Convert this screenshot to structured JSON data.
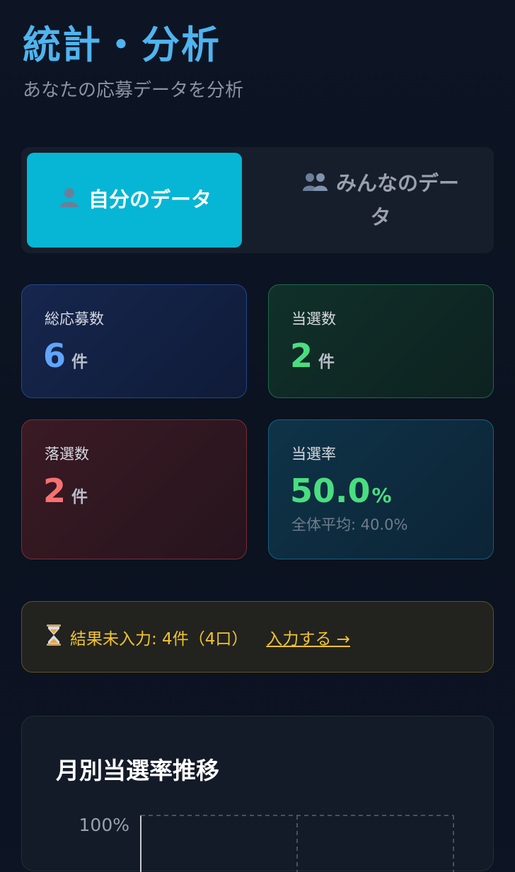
{
  "page": {
    "title": "統計・分析",
    "subtitle": "あなたの応募データを分析"
  },
  "tabs": [
    {
      "icon": "single-user-icon",
      "label": "自分のデータ",
      "active": true
    },
    {
      "icon": "group-users-icon",
      "label": "みんなのデータ",
      "active": false
    }
  ],
  "stats": {
    "total": {
      "label": "総応募数",
      "value": "6",
      "unit": "件"
    },
    "wins": {
      "label": "当選数",
      "value": "2",
      "unit": "件"
    },
    "losses": {
      "label": "落選数",
      "value": "2",
      "unit": "件"
    },
    "rate": {
      "label": "当選率",
      "value": "50.0",
      "unit": "%",
      "sub": "全体平均: 40.0%"
    }
  },
  "pending": {
    "icon": "hourglass-icon",
    "text": "結果未入力: 4件（4口）",
    "link": "入力する →"
  },
  "chart": {
    "title": "月別当選率推移"
  },
  "chart_data": {
    "type": "line",
    "title": "月別当選率推移",
    "y_tick_labels": [
      "100%"
    ],
    "grid": true
  },
  "colors": {
    "accent": "#06b6d4",
    "title": "#4fb4ef",
    "blue": "#60a5fa",
    "green": "#4ade80",
    "red": "#f87171",
    "warning": "#f4c430"
  }
}
